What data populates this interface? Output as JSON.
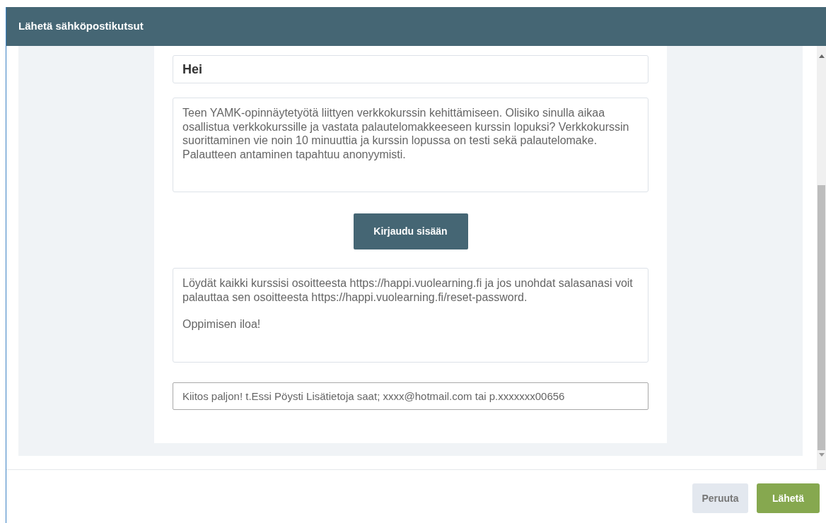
{
  "dialog": {
    "title": "Lähetä sähköpostikutsut"
  },
  "email": {
    "greeting": "Hei",
    "intro": "Teen YAMK-opinnäytetyötä liittyen verkkokurssin kehittämiseen. Olisiko sinulla aikaa osallistua verkkokurssille ja vastata palautelomakkeeseen kurssin lopuksi? Verkkokurssin suorittaminen vie noin 10 minuuttia ja kurssin lopussa on testi sekä palautelomake. Palautteen antaminen tapahtuu anonyymisti.",
    "login_button": "Kirjaudu sisään",
    "info": [
      "Löydät kaikki kurssisi osoitteesta https://happi.vuolearning.fi ja jos unohdat salasanasi voit palauttaa sen osoitteesta https://happi.vuolearning.fi/reset-password.",
      "Oppimisen iloa!"
    ],
    "signature": "Kiitos paljon! t.Essi Pöysti Lisätietoja saat; xxxx@hotmail.com tai p.xxxxxxx00656"
  },
  "buttons": [
    {
      "label": "Peruuta",
      "kind": "secondary"
    },
    {
      "label": "Lähetä",
      "kind": "primary"
    }
  ]
}
